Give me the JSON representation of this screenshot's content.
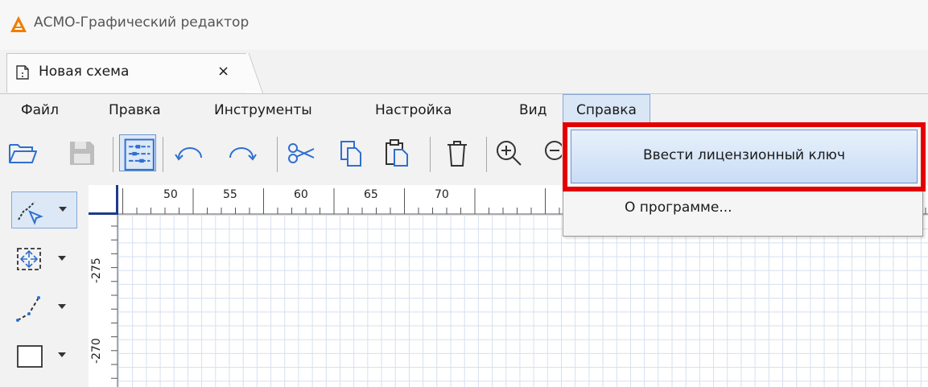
{
  "window": {
    "title": "АСМО-Графический редактор",
    "logo_icon": "asmo-logo-icon",
    "brand_color": "#f07e00"
  },
  "tabs": [
    {
      "label": "Новая схема",
      "close": "×"
    }
  ],
  "menu": {
    "file": "Файл",
    "edit": "Правка",
    "tools": "Инструменты",
    "settings": "Настройка",
    "view": "Вид",
    "help": "Справка"
  },
  "help_menu": {
    "items": [
      {
        "label": "Ввести лицензионный ключ",
        "highlighted": true
      },
      {
        "label": "О программе..."
      }
    ],
    "highlight_color": "#e40000"
  },
  "toolbar": {
    "icons": [
      "open-folder-icon",
      "save-icon",
      "grid-toggle-icon",
      "undo-icon",
      "redo-icon",
      "cut-icon",
      "copy-icon",
      "paste-icon",
      "delete-icon",
      "zoom-in-icon",
      "zoom-out-icon"
    ]
  },
  "left_tools": [
    "pointer-tool-icon",
    "resize-tool-icon",
    "line-tool-icon",
    "rectangle-tool-icon"
  ],
  "ruler": {
    "top_labels": [
      "50",
      "55",
      "60",
      "65",
      "70"
    ],
    "left_labels": [
      "-275",
      "-270"
    ]
  }
}
